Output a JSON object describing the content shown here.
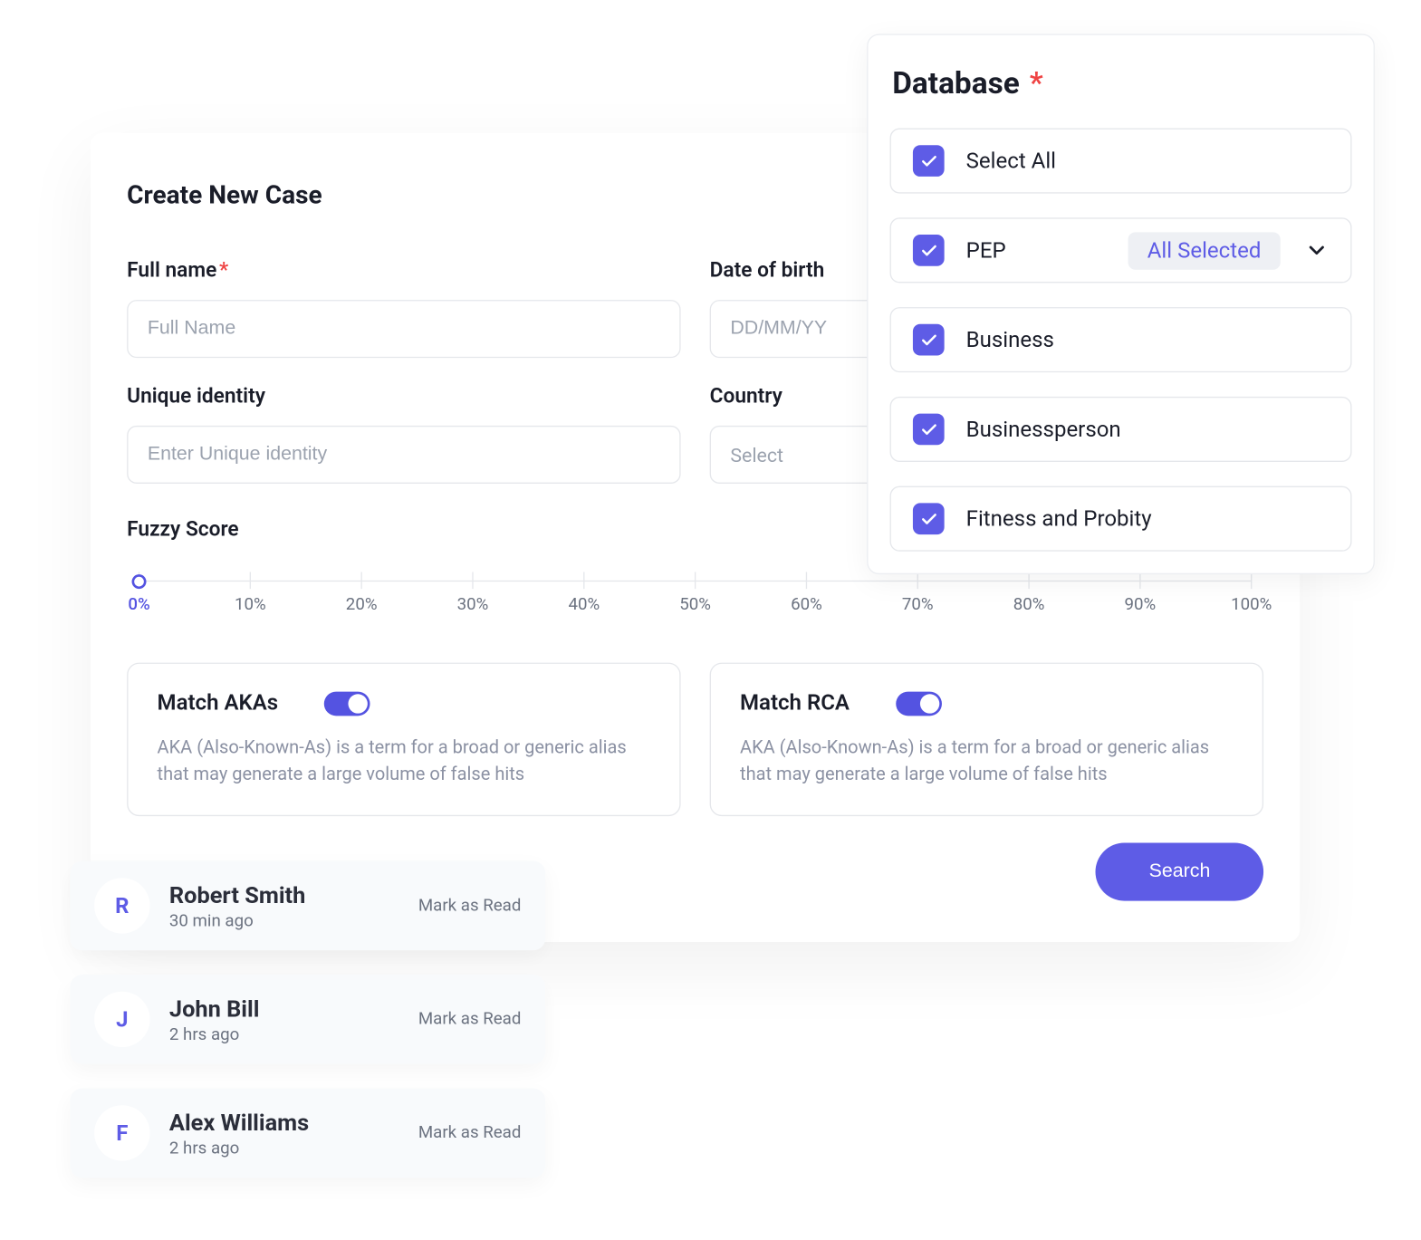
{
  "colors": {
    "accent": "#5e5ce6",
    "danger": "#ef4444"
  },
  "form": {
    "title": "Create New Case",
    "fields": {
      "fullName": {
        "label": "Full name",
        "required": true,
        "placeholder": "Full Name",
        "value": ""
      },
      "dob": {
        "label": "Date of birth",
        "placeholder": "DD/MM/YY",
        "value": ""
      },
      "uid": {
        "label": "Unique identity",
        "placeholder": "Enter Unique identity",
        "value": ""
      },
      "country": {
        "label": "Country",
        "placeholder": "Select",
        "value": ""
      }
    },
    "fuzzy": {
      "label": "Fuzzy Score",
      "ticks": [
        "0%",
        "10%",
        "20%",
        "30%",
        "40%",
        "50%",
        "60%",
        "70%",
        "80%",
        "90%",
        "100%"
      ],
      "valueIndex": 0
    },
    "cards": {
      "aka": {
        "title": "Match AKAs",
        "on": true,
        "desc": "AKA (Also-Known-As) is a term for a  broad or generic alias that may generate a large volume of false hits"
      },
      "rca": {
        "title": "Match RCA",
        "on": true,
        "desc": "AKA (Also-Known-As) is a term for a  broad or generic alias that may generate a large volume of false hits"
      }
    },
    "search_label": "Search"
  },
  "database": {
    "title": "Database",
    "required": true,
    "selectAll": {
      "label": "Select All",
      "checked": true
    },
    "items": [
      {
        "label": "PEP",
        "checked": true,
        "badge": "All Selected",
        "expandable": true
      },
      {
        "label": "Business",
        "checked": true
      },
      {
        "label": "Businessperson",
        "checked": true
      },
      {
        "label": "Fitness and Probity",
        "checked": true
      }
    ]
  },
  "activity": {
    "action_label": "Mark as Read",
    "items": [
      {
        "initial": "R",
        "name": "Robert Smith",
        "time": "30 min ago"
      },
      {
        "initial": "J",
        "name": "John Bill",
        "time": "2 hrs ago"
      },
      {
        "initial": "F",
        "name": "Alex Williams",
        "time": "2 hrs ago"
      }
    ]
  }
}
